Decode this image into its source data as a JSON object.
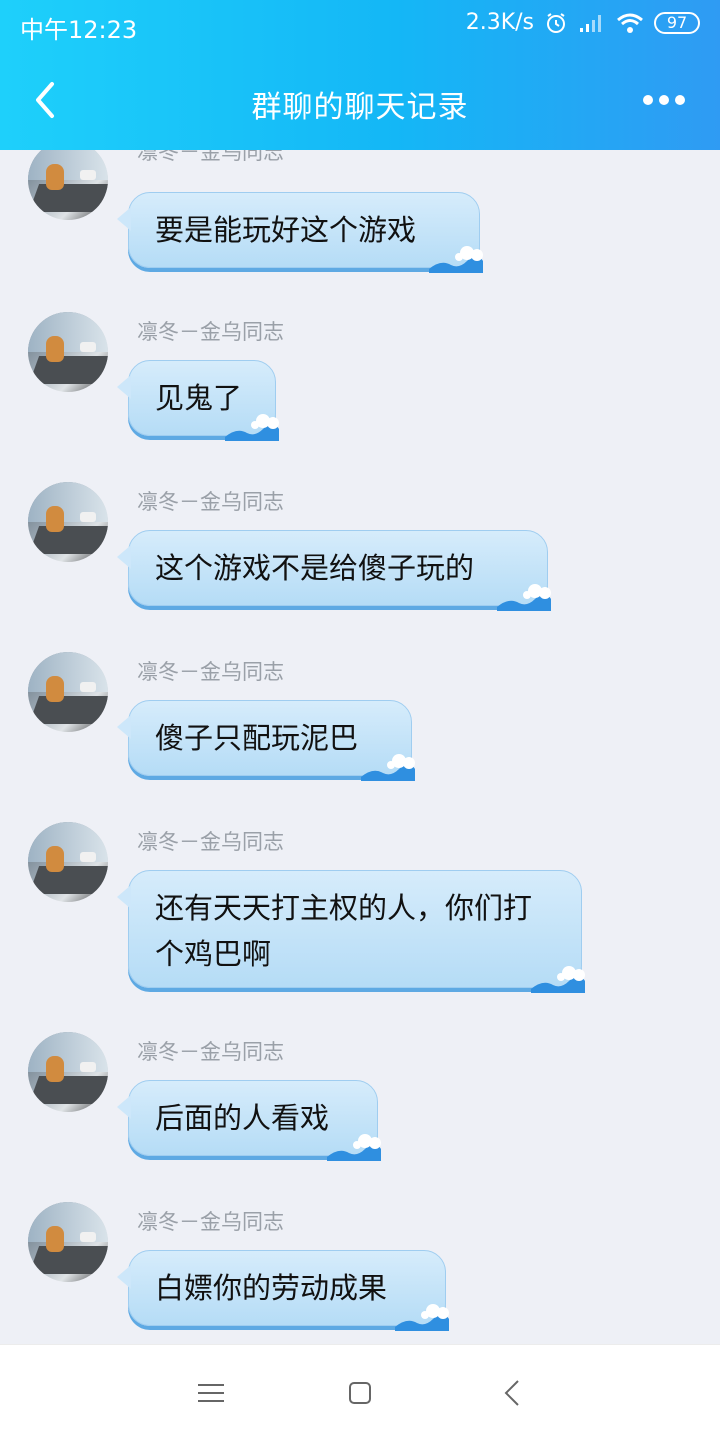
{
  "status_bar": {
    "time": "中午12:23",
    "speed": "2.3K/s",
    "battery": "97",
    "icons": [
      "alarm-icon",
      "signal-icon",
      "wifi-icon",
      "battery-icon"
    ]
  },
  "header": {
    "title": "群聊的聊天记录",
    "back_icon": "chevron-left-icon",
    "more_icon": "more-dots-icon"
  },
  "messages": [
    {
      "sender": "凛冬－金乌同志",
      "text": "要是能玩好这个游戏"
    },
    {
      "sender": "凛冬－金乌同志",
      "text": "见鬼了"
    },
    {
      "sender": "凛冬－金乌同志",
      "text": "这个游戏不是给傻子玩的"
    },
    {
      "sender": "凛冬－金乌同志",
      "text": "傻子只配玩泥巴"
    },
    {
      "sender": "凛冬－金乌同志",
      "text": "还有天天打主权的人，你们打个鸡巴啊"
    },
    {
      "sender": "凛冬－金乌同志",
      "text": "后面的人看戏"
    },
    {
      "sender": "凛冬－金乌同志",
      "text": "白嫖你的劳动成果"
    }
  ],
  "bottom_nav": {
    "icons": [
      "menu-icon",
      "home-icon",
      "back-icon"
    ]
  },
  "colors": {
    "header": "#14b7f6",
    "bubble": "#c6e4f9",
    "background": "#eef0f6"
  }
}
